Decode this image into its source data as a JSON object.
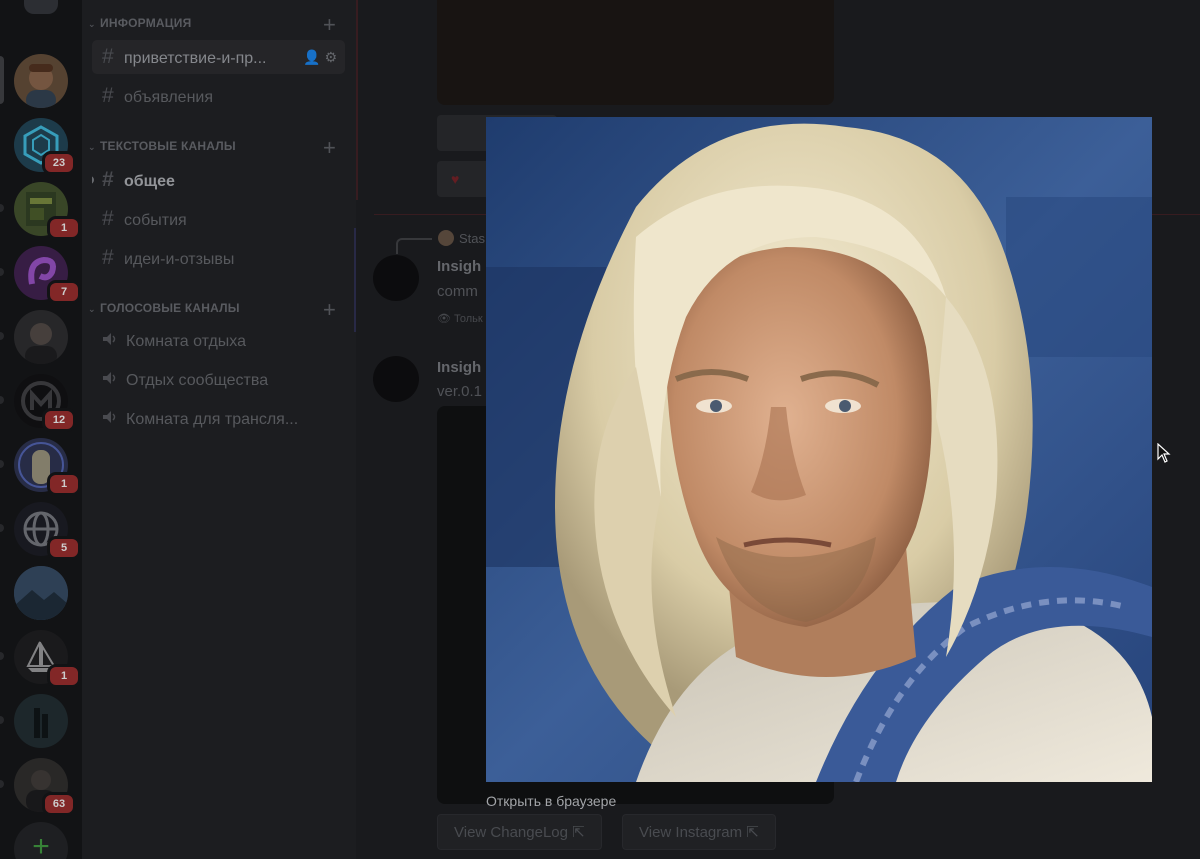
{
  "server_rail": {
    "servers": [
      {
        "name": "portrait-server",
        "badge": "",
        "color": "#5a4634"
      },
      {
        "name": "hex-server",
        "badge": "23",
        "color": "#1f3f4f"
      },
      {
        "name": "map-server",
        "badge": "1",
        "color": "#3d4a2a"
      },
      {
        "name": "purple-server",
        "badge": "7",
        "color": "#3a1f48"
      },
      {
        "name": "man-server",
        "badge": "",
        "color": "#2a2a2c"
      },
      {
        "name": "logo-server",
        "badge": "12",
        "color": "#101012"
      },
      {
        "name": "anime-server",
        "badge": "1",
        "color": "#2a2f4a"
      },
      {
        "name": "globe-server",
        "badge": "5",
        "color": "#1a1b22"
      },
      {
        "name": "concept-art-server",
        "badge": "",
        "color": "#2d3e52"
      },
      {
        "name": "midjourney-server",
        "badge": "1",
        "color": "#1c1c1e"
      },
      {
        "name": "castle-server",
        "badge": "",
        "color": "#1f2a2e"
      },
      {
        "name": "avatar-server",
        "badge": "63",
        "color": "#2c2b2a"
      }
    ]
  },
  "sidebar": {
    "categories": {
      "info": "ИНФОРМАЦИЯ",
      "text": "ТЕКСТОВЫЕ КАНАЛЫ",
      "voice": "ГОЛОСОВЫЕ КАНАЛЫ"
    },
    "info_channels": [
      "приветствие-и-пр...",
      "объявления"
    ],
    "text_channels": [
      "общее",
      "события",
      "идеи-и-отзывы"
    ],
    "voice_channels": [
      "Комната отдыха",
      "Отдых сообщества",
      "Комната для трансля..."
    ]
  },
  "chat": {
    "reply_name": "Stas",
    "msg1_name": "Insigh",
    "msg1_text": "comm",
    "ephemeral": "Тольк",
    "msg2_name": "Insigh",
    "msg2_text": "ver.0.1",
    "changelog_button": "View ChangeLog",
    "instagram_button": "View Instagram"
  },
  "modal": {
    "open_in_browser": "Открыть в браузере"
  },
  "colors": {
    "hair": "#e6dcc0",
    "background_blue": "#2f4f86",
    "skin": "#c99a78",
    "cloth": "#ddd8cc",
    "sash": "#3a5a98"
  }
}
